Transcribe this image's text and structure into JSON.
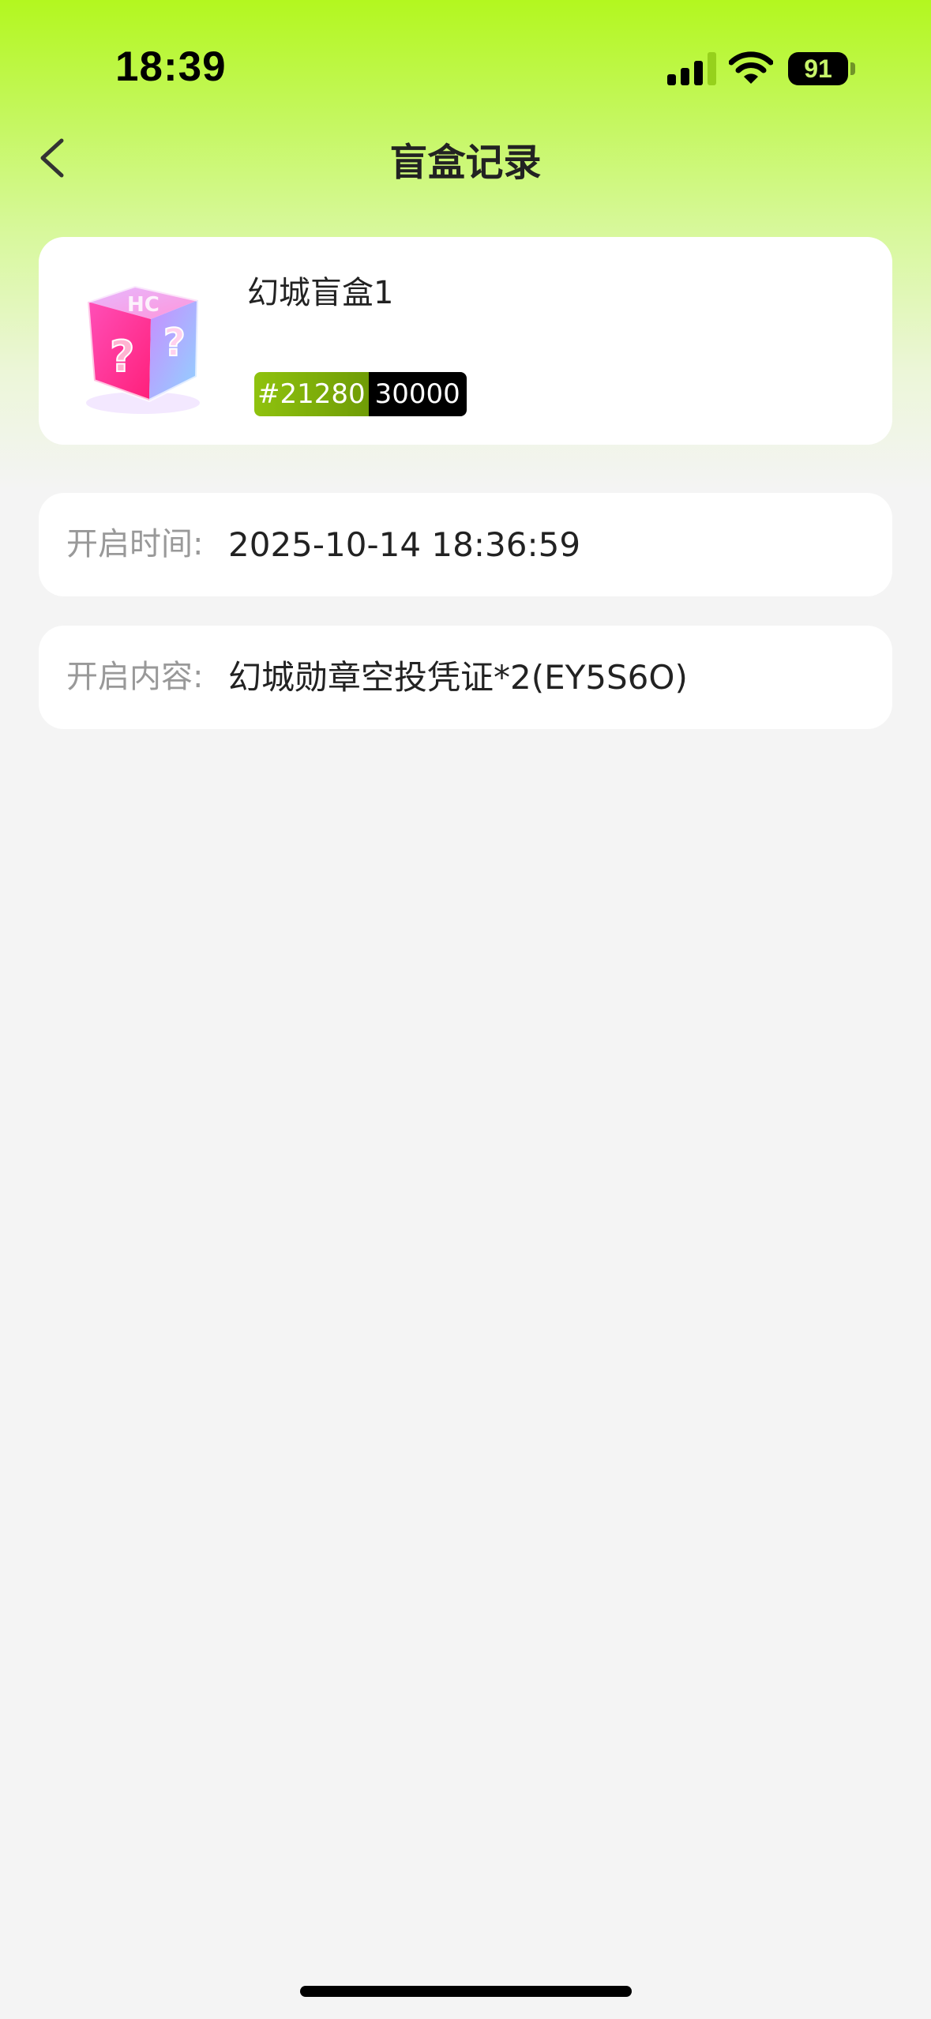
{
  "status_bar": {
    "time": "18:39",
    "battery": "91",
    "icons": [
      "signal-icon",
      "wifi-icon",
      "battery-icon"
    ]
  },
  "nav": {
    "title": "盲盒记录",
    "back_icon": "chevron-left-icon"
  },
  "box": {
    "name": "幻城盲盒1",
    "edition_number": "#21280",
    "edition_total": "30000",
    "image": "blind-box-cube-icon"
  },
  "details": {
    "open_time_label": "开启时间:",
    "open_time": "2025-10-14 18:36:59",
    "open_content_label": "开启内容:",
    "open_content": "幻城勋章空投凭证*2(EY5S6O)"
  },
  "colors": {
    "accent": "#b3f71f",
    "tag_green": "#7fad0a",
    "tag_black": "#000000",
    "background": "#f4f4f4"
  }
}
